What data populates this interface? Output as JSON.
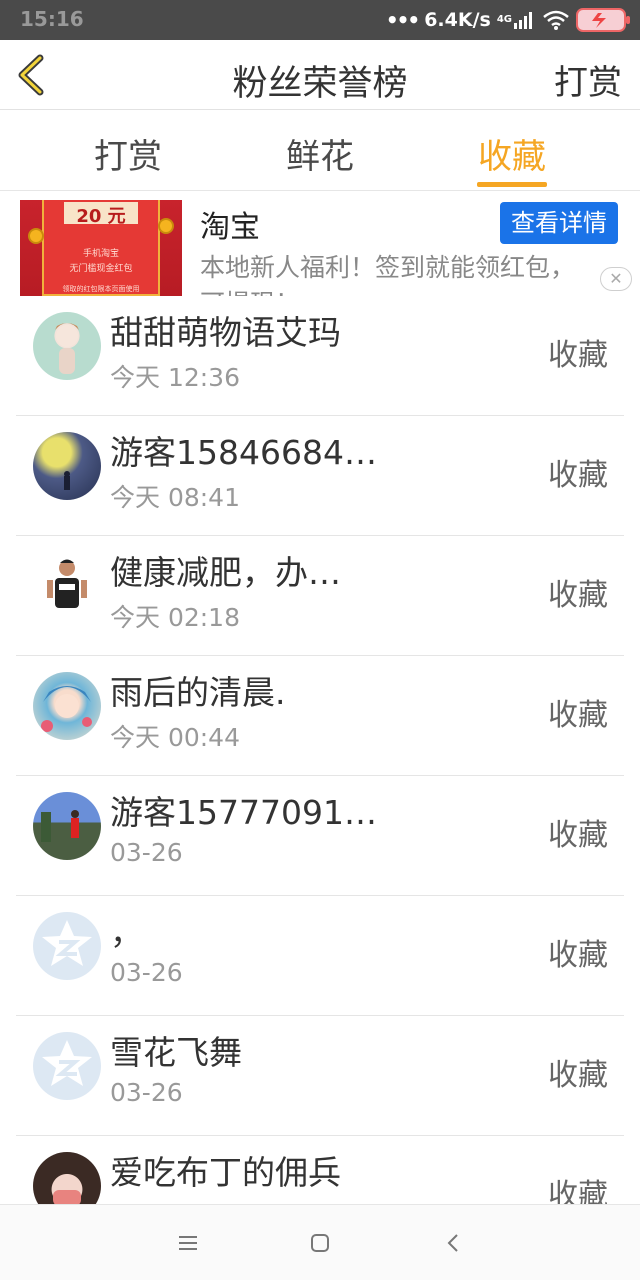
{
  "status_bar": {
    "time": "15:16",
    "speed": "6.4K/s",
    "network": "4G"
  },
  "header": {
    "title": "粉丝荣誉榜",
    "action": "打赏"
  },
  "tabs": [
    {
      "label": "打赏",
      "active": false
    },
    {
      "label": "鲜花",
      "active": false
    },
    {
      "label": "收藏",
      "active": true
    }
  ],
  "accent_color": "#f5a623",
  "ad": {
    "brand": "淘宝",
    "button": "查看详情",
    "description": "本地新人福利！签到就能领红包，",
    "description_more": "可提现！",
    "thumb_amount": "20 元",
    "thumb_line1": "手机淘宝",
    "thumb_line2": "无门槛现金红包",
    "thumb_line3": "领取的红包限本页面使用",
    "close_icon": "close-icon"
  },
  "fans": [
    {
      "name": "甜甜萌物语艾玛",
      "time": "今天 12:36",
      "status": "收藏"
    },
    {
      "name": "游客15846684…",
      "time": "今天 08:41",
      "status": "收藏"
    },
    {
      "name": "健康减肥，办…",
      "time": "今天 02:18",
      "status": "收藏"
    },
    {
      "name": "雨后的清晨.",
      "time": "今天 00:44",
      "status": "收藏"
    },
    {
      "name": "游客15777091…",
      "time": "03-26",
      "status": "收藏"
    },
    {
      "name": "，",
      "time": "03-26",
      "status": "收藏"
    },
    {
      "name": "雪花飞舞",
      "time": "03-26",
      "status": "收藏"
    },
    {
      "name": "爱吃布丁的佣兵",
      "time": "",
      "status": "收藏"
    }
  ]
}
